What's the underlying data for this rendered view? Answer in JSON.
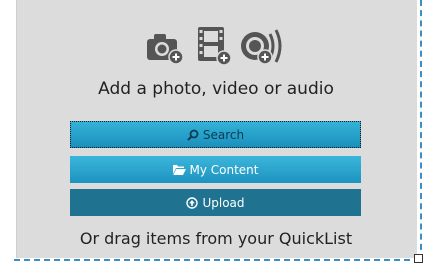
{
  "media_icons": [
    "camera-add-icon",
    "film-add-icon",
    "audio-add-icon"
  ],
  "headline": "Add a photo, video or audio",
  "buttons": {
    "search": "Search",
    "my_content": "My Content",
    "upload": "Upload"
  },
  "footer": "Or drag items from your QuickList",
  "colors": {
    "panel_bg": "#dcdcdc",
    "button_primary": "#1d93bf",
    "button_dark": "#1f7391",
    "dashed_border": "#3b8fc4",
    "icon": "#555555"
  }
}
